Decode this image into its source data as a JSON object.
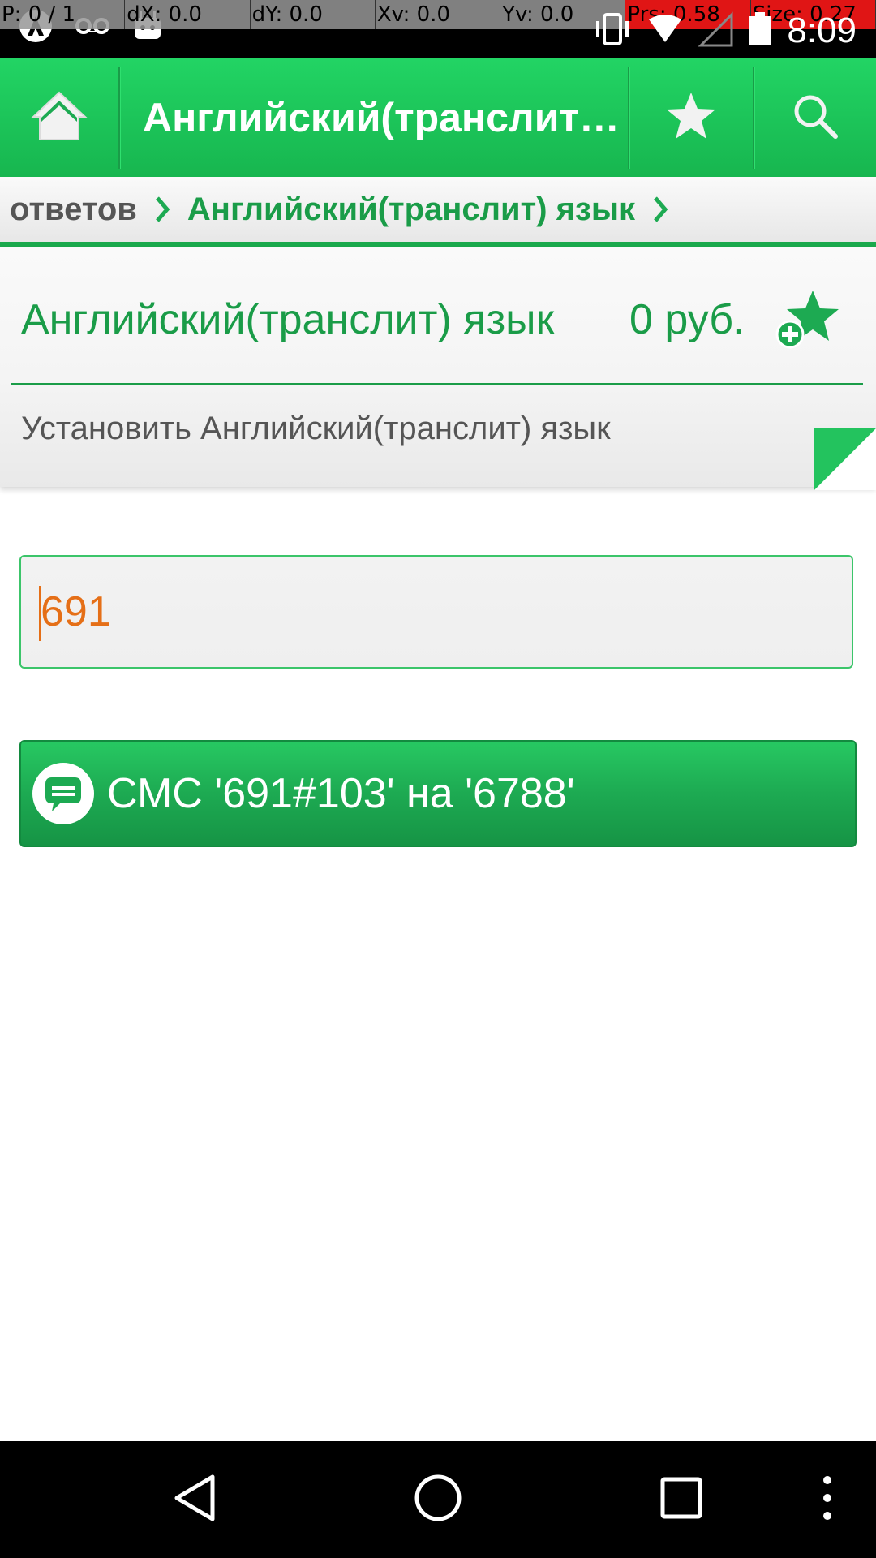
{
  "status_bar": {
    "debug": [
      "P: 0 / 1",
      "dX: 0.0",
      "dY: 0.0",
      "Xv: 0.0",
      "Yv: 0.0",
      "Prs: 0.58",
      "Size: 0.27"
    ],
    "time": "8:09"
  },
  "action_bar": {
    "title": "Английский(транслит) язык",
    "icons": [
      "home-icon",
      "star-icon",
      "search-icon"
    ]
  },
  "breadcrumb": {
    "previous": "ответов",
    "current": "Английский(транслит) язык"
  },
  "item": {
    "title": "Английский(транслит) язык",
    "price": "0 руб.",
    "description": "Установить Английский(транслит) язык"
  },
  "code_input": {
    "value": "691"
  },
  "sms_button": {
    "label": "СМС '691#103' на '6788'"
  },
  "colors": {
    "accent_green": "#1a9c48",
    "bar_green": "#22d464",
    "input_text": "#e56f17"
  }
}
